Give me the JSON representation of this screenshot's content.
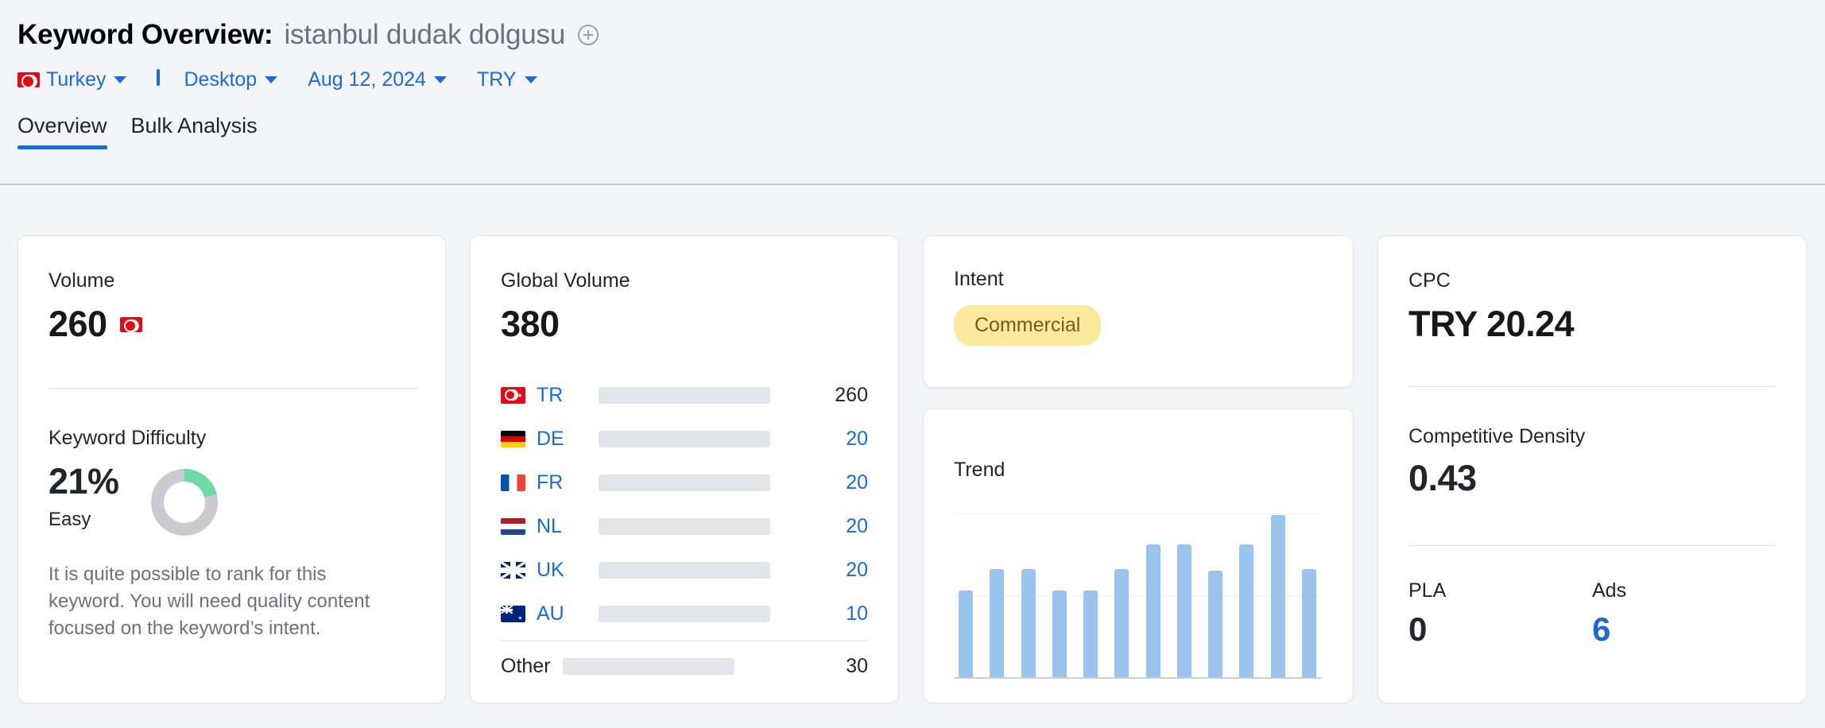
{
  "header": {
    "title_prefix": "Keyword Overview:",
    "keyword": "istanbul dudak dolgusu",
    "add_icon": "plus-circle-icon",
    "filters": [
      {
        "label": "Turkey",
        "icon": "turkey-flag-icon"
      },
      {
        "label": "Desktop",
        "icon": "monitor-icon"
      },
      {
        "label": "Aug 12, 2024",
        "icon": ""
      },
      {
        "label": "TRY",
        "icon": ""
      }
    ]
  },
  "tabs": [
    {
      "label": "Overview",
      "active": true
    },
    {
      "label": "Bulk Analysis",
      "active": false
    }
  ],
  "volume_card": {
    "title": "Volume",
    "value": "260",
    "flag": "turkey-flag-icon",
    "difficulty_label": "Keyword Difficulty",
    "difficulty_value": "21%",
    "difficulty_level": "Easy",
    "difficulty_percent": 21,
    "description": "It is quite possible to rank for this keyword. You will need quality content focused on the keyword’s intent.",
    "gauge_color": "#6fdaa5",
    "gauge_track": "#c9cbd0"
  },
  "global_card": {
    "title": "Global Volume",
    "value": "380",
    "other_label": "Other",
    "other_value": "30",
    "other_percent": 13,
    "rows": [
      {
        "code": "TR",
        "flag": "turkey-flag-icon",
        "value": "260",
        "percent": 69,
        "color": "#2a6fd1",
        "value_link": false
      },
      {
        "code": "DE",
        "flag": "germany-flag-icon",
        "value": "20",
        "percent": 13,
        "color": "#4ea6f5",
        "value_link": true
      },
      {
        "code": "FR",
        "flag": "france-flag-icon",
        "value": "20",
        "percent": 13,
        "color": "#4ea6f5",
        "value_link": true
      },
      {
        "code": "NL",
        "flag": "netherlands-flag-icon",
        "value": "20",
        "percent": 13,
        "color": "#4ea6f5",
        "value_link": true
      },
      {
        "code": "UK",
        "flag": "uk-flag-icon",
        "value": "20",
        "percent": 13,
        "color": "#4ea6f5",
        "value_link": true
      },
      {
        "code": "AU",
        "flag": "australia-flag-icon",
        "value": "10",
        "percent": 8,
        "color": "#4ea6f5",
        "value_link": true
      }
    ]
  },
  "intent_card": {
    "title": "Intent",
    "badge": "Commercial",
    "badge_bg": "#fbe99e",
    "badge_color": "#7a5a19"
  },
  "trend_card": {
    "title": "Trend"
  },
  "cpc_card": {
    "title": "CPC",
    "value": "TRY 20.24",
    "density_label": "Competitive Density",
    "density_value": "0.43",
    "pla_label": "PLA",
    "pla_value": "0",
    "ads_label": "Ads",
    "ads_value": "6"
  },
  "chart_data": {
    "type": "bar",
    "title": "Trend",
    "categories": [
      "1",
      "2",
      "3",
      "4",
      "5",
      "6",
      "7",
      "8",
      "9",
      "10",
      "11",
      "12"
    ],
    "values": [
      53,
      66,
      66,
      53,
      53,
      66,
      81,
      81,
      65,
      81,
      99,
      66
    ],
    "xlabel": "",
    "ylabel": "",
    "ylim": [
      0,
      100
    ],
    "grid": true,
    "legend": "none",
    "bar_color": "#9ac4ee"
  }
}
